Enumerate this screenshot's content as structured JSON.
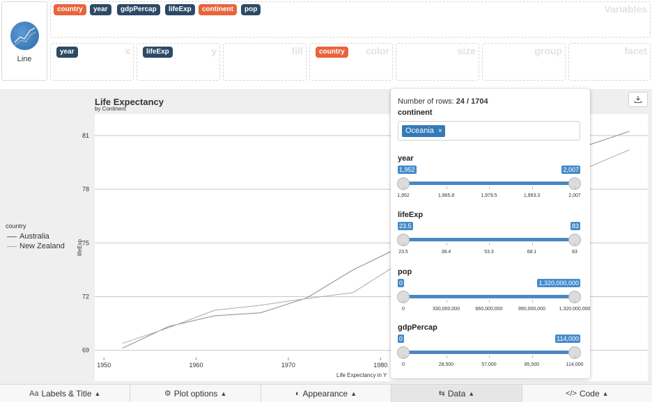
{
  "geom": {
    "label": "Line",
    "icon": "line-chart-icon"
  },
  "variables": {
    "section_label": "Variables",
    "chips": [
      {
        "label": "country",
        "color": "#e8643b"
      },
      {
        "label": "year",
        "color": "#2c4a66"
      },
      {
        "label": "gdpPercap",
        "color": "#2c4a66"
      },
      {
        "label": "lifeExp",
        "color": "#2c4a66"
      },
      {
        "label": "continent",
        "color": "#e8643b"
      },
      {
        "label": "pop",
        "color": "#2c4a66"
      }
    ]
  },
  "aesthetics": [
    {
      "label": "x",
      "value": "year"
    },
    {
      "label": "y",
      "value": "lifeExp"
    },
    {
      "label": "fill",
      "value": ""
    },
    {
      "label": "color",
      "value": "country"
    },
    {
      "label": "size",
      "value": ""
    },
    {
      "label": "group",
      "value": ""
    },
    {
      "label": "facet",
      "value": ""
    }
  ],
  "chart_data": {
    "type": "line",
    "title": "Life Expectancy",
    "subtitle": "by Continent",
    "xlabel": "Life Expectancy in Y",
    "ylabel": "lifeExp",
    "xlim": [
      1949,
      2009
    ],
    "ylim": [
      68.6,
      82.2
    ],
    "x_ticks": [
      1950,
      1960,
      1970,
      1980
    ],
    "y_ticks": [
      69,
      72,
      75,
      78,
      81
    ],
    "grid": true,
    "legend_title": "country",
    "legend_position": "left",
    "series": [
      {
        "name": "Australia",
        "color": "#888888",
        "x": [
          1952,
          1957,
          1962,
          1967,
          1972,
          1977,
          1982,
          1987,
          1992,
          1997,
          2002,
          2007
        ],
        "y": [
          69.12,
          70.33,
          70.93,
          71.1,
          71.93,
          73.49,
          74.74,
          76.32,
          77.56,
          78.83,
          80.37,
          81.235
        ]
      },
      {
        "name": "New Zealand",
        "color": "#aaaaaa",
        "x": [
          1952,
          1957,
          1962,
          1967,
          1972,
          1977,
          1982,
          1987,
          1992,
          1997,
          2002,
          2007
        ],
        "y": [
          69.39,
          70.26,
          71.24,
          71.52,
          71.89,
          72.22,
          73.84,
          74.32,
          76.33,
          77.55,
          79.11,
          80.204
        ]
      }
    ]
  },
  "filter": {
    "rows_label": "Number of rows:",
    "rows_value": "24 / 1704",
    "continent": {
      "label": "continent",
      "selected": "Oceania",
      "remove": "×"
    },
    "sliders": [
      {
        "label": "year",
        "min_label": "1,952",
        "max_label": "2,007",
        "value_min": 1952,
        "value_max": 2007,
        "min": 1952,
        "max": 2007,
        "ticks": [
          "1,952",
          "1,965.8",
          "1,979.5",
          "1,993.3",
          "2,007"
        ]
      },
      {
        "label": "lifeExp",
        "min_label": "23.5",
        "max_label": "83",
        "value_min": 23.5,
        "value_max": 83,
        "min": 23.5,
        "max": 83,
        "ticks": [
          "23.5",
          "38.4",
          "53.3",
          "68.1",
          "83"
        ]
      },
      {
        "label": "pop",
        "min_label": "0",
        "max_label": "1,320,000,000",
        "value_min": 0,
        "value_max": 1320000000,
        "min": 0,
        "max": 1320000000,
        "ticks": [
          "0",
          "330,000,000",
          "660,000,000",
          "990,000,000",
          "1,320,000,000"
        ]
      },
      {
        "label": "gdpPercap",
        "min_label": "0",
        "max_label": "114,000",
        "value_min": 0,
        "value_max": 114000,
        "min": 0,
        "max": 114000,
        "ticks": [
          "0",
          "28,500",
          "57,000",
          "85,500",
          "114,000"
        ]
      }
    ]
  },
  "tabs": [
    {
      "label": "Labels & Title",
      "icon_text": "Aa",
      "active": false
    },
    {
      "label": "Plot options",
      "icon_text": "⚙",
      "active": false
    },
    {
      "label": "Appearance",
      "icon_text": "◐",
      "active": false
    },
    {
      "label": "Data",
      "icon_text": "⇆",
      "active": true
    },
    {
      "label": "Code",
      "icon_text": "</>",
      "active": false
    }
  ],
  "caret": "▲"
}
